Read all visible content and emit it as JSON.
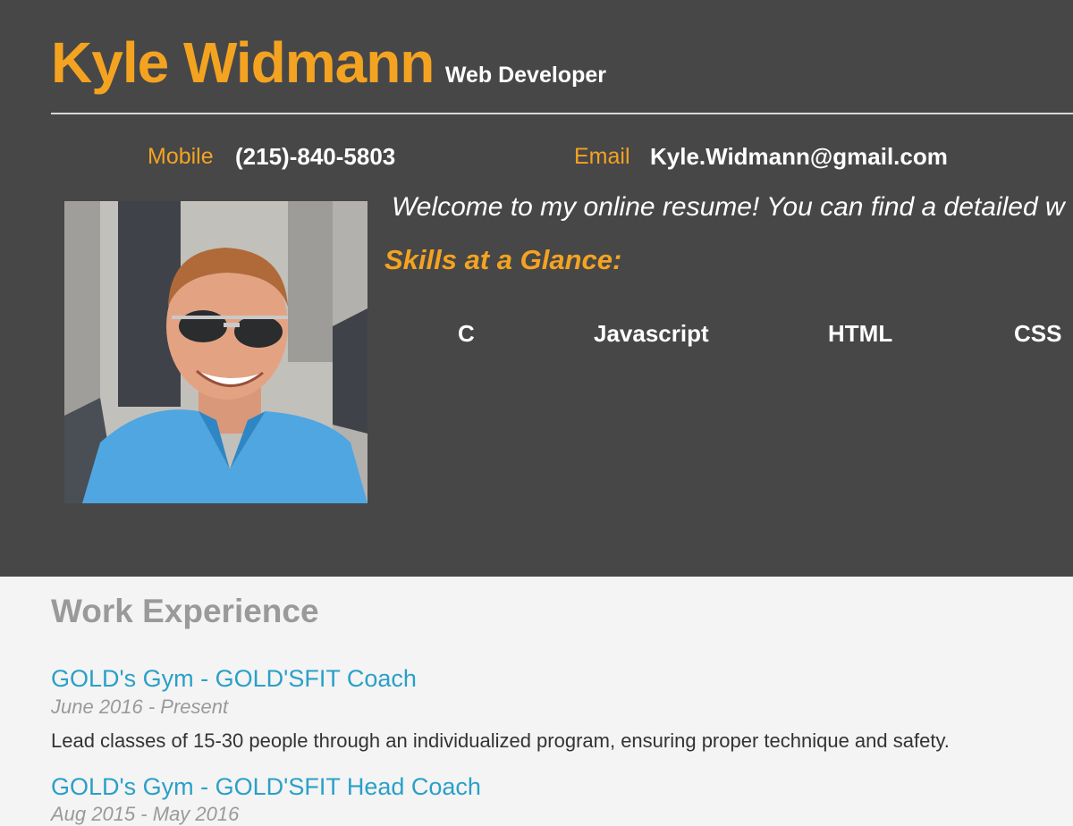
{
  "header": {
    "name": "Kyle Widmann",
    "title": "Web Developer",
    "contact": {
      "mobile_label": "Mobile",
      "mobile_value": "(215)-840-5803",
      "email_label": "Email",
      "email_value": "Kyle.Widmann@gmail.com"
    },
    "welcome": "Welcome to my online resume! You can find a detailed w",
    "skills_heading": "Skills at a Glance:",
    "skills": [
      "C",
      "Javascript",
      "HTML",
      "CSS"
    ]
  },
  "work": {
    "heading": "Work Experience",
    "jobs": [
      {
        "title": "GOLD's Gym - GOLD'SFIT Coach",
        "dates": "June 2016 - Present",
        "description": "Lead classes of 15-30 people through an individualized program, ensuring proper technique and safety."
      },
      {
        "title": "GOLD's Gym - GOLD'SFIT Head Coach",
        "dates": "Aug 2015 - May 2016"
      }
    ]
  },
  "colors": {
    "header_bg": "#474747",
    "accent_orange": "#f4a321",
    "link_blue": "#2aa0c8",
    "body_bg": "#f4f4f4"
  }
}
